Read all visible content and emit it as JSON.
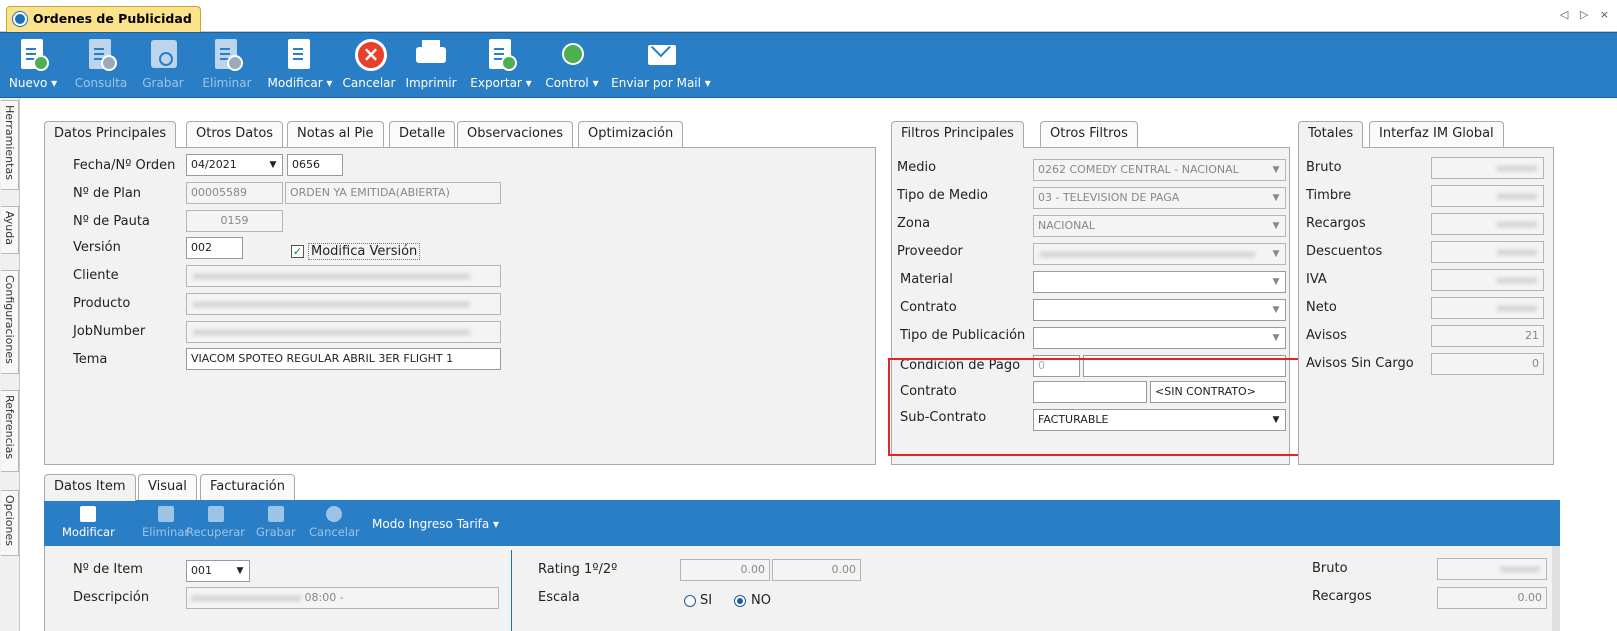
{
  "window": {
    "tab_title": "Ordenes de Publicidad",
    "nav_arrows": "◁ ▷ ×"
  },
  "ribbon": {
    "buttons": [
      {
        "label": "Nuevo ▾",
        "enabled": true,
        "icon": "new-doc-icon"
      },
      {
        "label": "Consulta",
        "enabled": false,
        "icon": "query-doc-icon"
      },
      {
        "label": "Grabar",
        "enabled": false,
        "icon": "save-disk-icon"
      },
      {
        "label": "Eliminar",
        "enabled": false,
        "icon": "delete-doc-icon"
      },
      {
        "label": "Modificar ▾",
        "enabled": true,
        "icon": "edit-doc-icon"
      },
      {
        "label": "Cancelar",
        "enabled": true,
        "icon": "cancel-icon"
      },
      {
        "label": "Imprimir",
        "enabled": true,
        "icon": "printer-icon"
      },
      {
        "label": "Exportar ▾",
        "enabled": true,
        "icon": "export-doc-icon"
      },
      {
        "label": "Control ▾",
        "enabled": true,
        "icon": "control-icon"
      },
      {
        "label": "Enviar por Mail ▾",
        "enabled": true,
        "icon": "mail-icon"
      }
    ]
  },
  "sidebar": {
    "tabs": [
      "Herramientas",
      "Ayuda",
      "Configuraciones",
      "Referencias",
      "Opciones"
    ]
  },
  "main_tabs": [
    "Datos Principales",
    "Otros Datos",
    "Notas al Pie",
    "Detalle",
    "Observaciones",
    "Optimización"
  ],
  "datos_principales": {
    "fecha_label": "Fecha/Nº Orden",
    "fecha_value": "04/2021",
    "orden_value": "0656",
    "plan_label": "Nº de Plan",
    "plan_value": "00005589",
    "plan_status": "ORDEN YA EMITIDA(ABIERTA)",
    "pauta_label": "Nº de Pauta",
    "pauta_value": "0159",
    "version_label": "Versión",
    "version_value": "002",
    "modifica_label": "Modifica Versión",
    "modifica_checked": true,
    "cliente_label": "Cliente",
    "producto_label": "Producto",
    "jobnumber_label": "JobNumber",
    "tema_label": "Tema",
    "tema_value": "VIACOM SPOTEO REGULAR ABRIL 3ER FLIGHT 1"
  },
  "filter_tabs": [
    "Filtros Principales",
    "Otros Filtros"
  ],
  "filtros": {
    "medio_label": "Medio",
    "medio_value": "0262 COMEDY CENTRAL - NACIONAL",
    "tipo_medio_label": "Tipo de Medio",
    "tipo_medio_value": "03 - TELEVISION DE PAGA",
    "zona_label": "Zona",
    "zona_value": "NACIONAL",
    "proveedor_label": "Proveedor",
    "material_label": "Material",
    "contrato_label": "Contrato",
    "tipo_pub_label": "Tipo de Publicación",
    "condicion_label": "Condición de Pago",
    "condicion_value": "0",
    "contrato2_label": "Contrato",
    "sin_contrato": "<SIN CONTRATO>",
    "subcontrato_label": "Sub-Contrato",
    "subcontrato_value": "FACTURABLE"
  },
  "totals_tabs": [
    "Totales",
    "Interfaz IM Global"
  ],
  "totales": {
    "bruto_label": "Bruto",
    "timbre_label": "Timbre",
    "recargos_label": "Recargos",
    "descuentos_label": "Descuentos",
    "iva_label": "IVA",
    "neto_label": "Neto",
    "avisos_label": "Avisos",
    "avisos_value": "21",
    "avisos_sin_cargo_label": "Avisos Sin Cargo",
    "avisos_sin_cargo_value": "0"
  },
  "item_tabs": [
    "Datos Item",
    "Visual",
    "Facturación"
  ],
  "item_toolbar": {
    "buttons": [
      {
        "label": "Modificar",
        "enabled": true
      },
      {
        "label": "Eliminar",
        "enabled": false
      },
      {
        "label": "Recuperar",
        "enabled": false
      },
      {
        "label": "Grabar",
        "enabled": false
      },
      {
        "label": "Cancelar",
        "enabled": false
      }
    ],
    "modo_label": "Modo Ingreso Tarifa ▾"
  },
  "item": {
    "nro_item_label": "Nº de Item",
    "nro_item_value": "001",
    "descripcion_label": "Descripción",
    "descripcion_suffix": "08:00 -",
    "rating_label": "Rating 1º/2º",
    "rating_1": "0.00",
    "rating_2": "0.00",
    "escala_label": "Escala",
    "escala_si": "SI",
    "escala_no": "NO",
    "escala_selected": "NO",
    "bruto_label": "Bruto",
    "recargos_label": "Recargos",
    "recargos_value": "0.00"
  },
  "colors": {
    "ribbon_blue": "#2a7ec6",
    "tab_highlight": "#fbe38e",
    "highlight_box": "#e32424"
  }
}
